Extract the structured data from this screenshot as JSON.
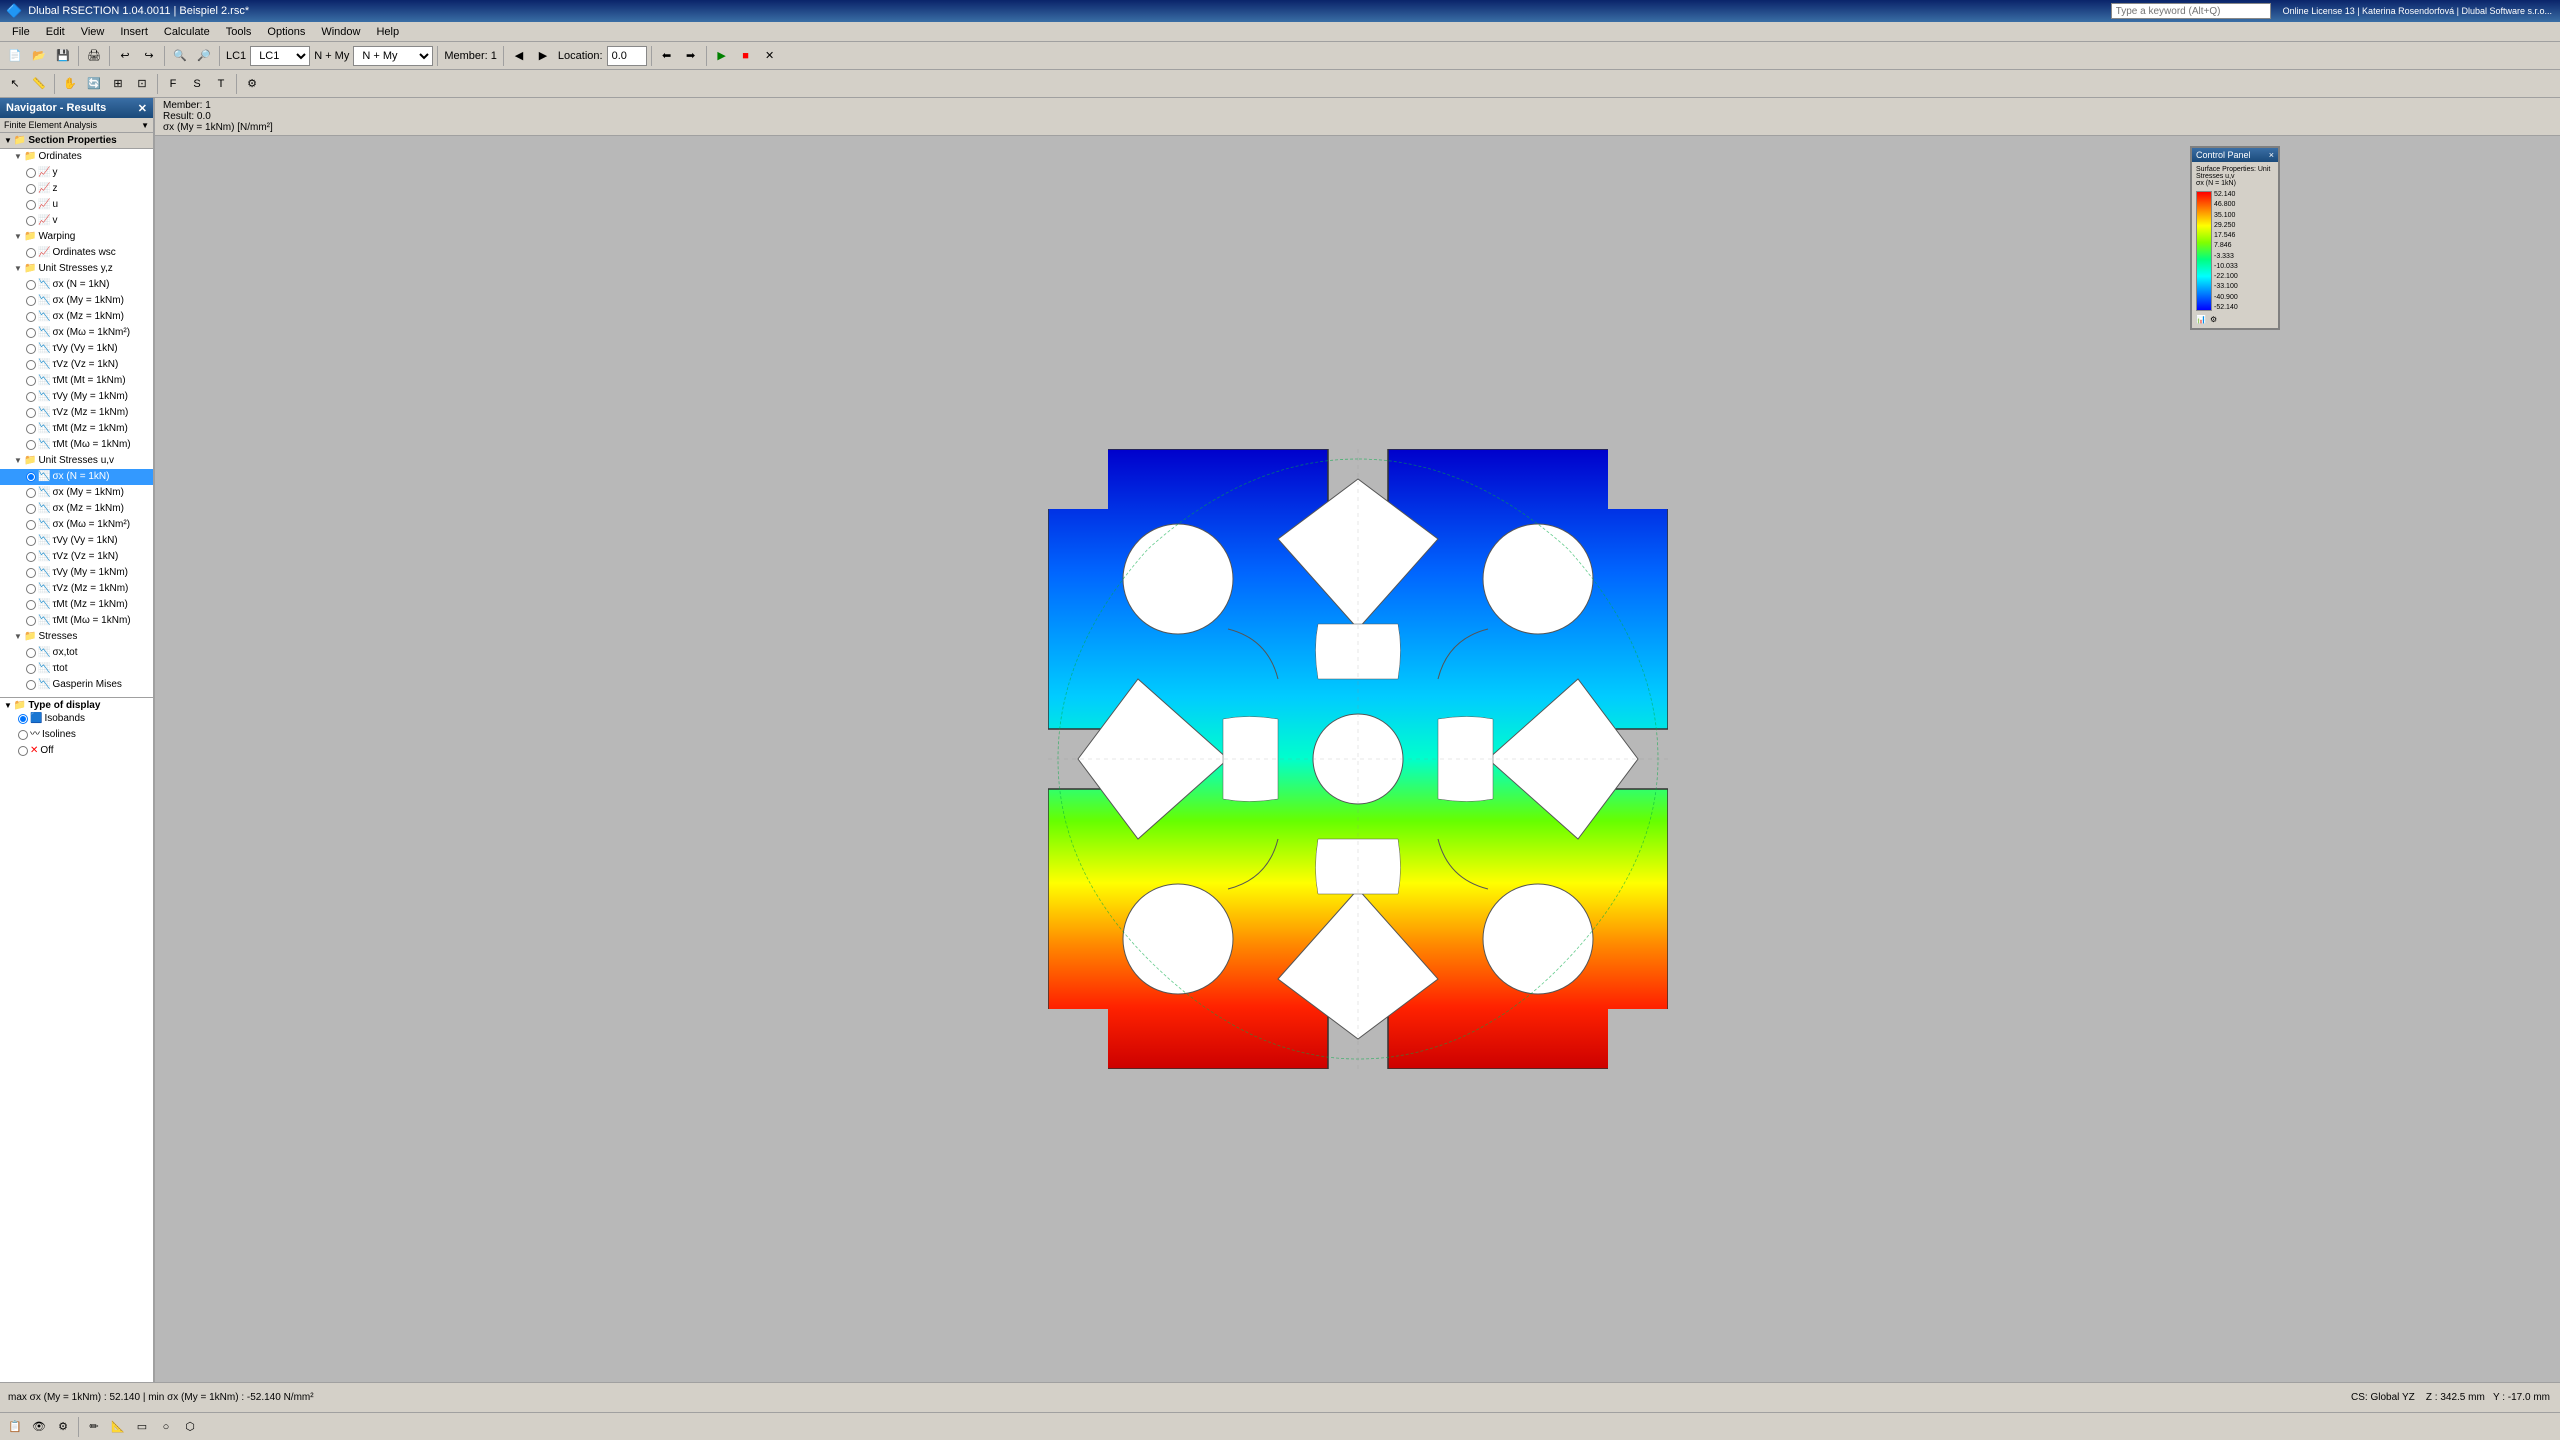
{
  "titlebar": {
    "title": "Dlubal RSECTION 1.04.0011 | Beispiel 2.rsc*",
    "min_label": "─",
    "max_label": "□",
    "close_label": "✕"
  },
  "menubar": {
    "items": [
      "File",
      "Edit",
      "View",
      "Insert",
      "Calculate",
      "Tools",
      "Options",
      "Window",
      "Help"
    ]
  },
  "toolbar1": {
    "lc_combo": "LC1",
    "n_my_combo": "N + My",
    "member_label": "Member: 1",
    "location_label": "Location:",
    "location_value": "0.0"
  },
  "navigator": {
    "title": "Navigator - Results",
    "tab_label": "Finite Element Analysis",
    "section_properties": "Section Properties",
    "tree": [
      {
        "label": "Ordinates",
        "level": 1,
        "type": "folder"
      },
      {
        "label": "y",
        "level": 2,
        "type": "radio"
      },
      {
        "label": "z",
        "level": 2,
        "type": "radio"
      },
      {
        "label": "u",
        "level": 2,
        "type": "radio"
      },
      {
        "label": "v",
        "level": 2,
        "type": "radio"
      },
      {
        "label": "Warping",
        "level": 1,
        "type": "folder"
      },
      {
        "label": "Ordinates wsc",
        "level": 2,
        "type": "radio"
      },
      {
        "label": "Unit Stresses y,z",
        "level": 1,
        "type": "folder"
      },
      {
        "label": "σx (N = 1kN)",
        "level": 2,
        "type": "radio"
      },
      {
        "label": "σx (My = 1kNm)",
        "level": 2,
        "type": "radio"
      },
      {
        "label": "σx (Mz = 1kNm)",
        "level": 2,
        "type": "radio"
      },
      {
        "label": "σx (Mω = 1kNm²)",
        "level": 2,
        "type": "radio"
      },
      {
        "label": "τVy (Vy = 1kN)",
        "level": 2,
        "type": "radio"
      },
      {
        "label": "τVz (Vz = 1kN)",
        "level": 2,
        "type": "radio"
      },
      {
        "label": "τMt (Mt = 1kNm)",
        "level": 2,
        "type": "radio"
      },
      {
        "label": "τVy (My = 1kNm)",
        "level": 2,
        "type": "radio"
      },
      {
        "label": "τVz (Mz = 1kNm)",
        "level": 2,
        "type": "radio"
      },
      {
        "label": "τMt (Mz = 1kNm)",
        "level": 2,
        "type": "radio"
      },
      {
        "label": "τMt (Mω = 1kNm)",
        "level": 2,
        "type": "radio"
      },
      {
        "label": "Unit Stresses u,v",
        "level": 1,
        "type": "folder"
      },
      {
        "label": "σx (N = 1kN)",
        "level": 2,
        "type": "radio",
        "selected": true
      },
      {
        "label": "σx (My = 1kNm)",
        "level": 2,
        "type": "radio"
      },
      {
        "label": "σx (Mz = 1kNm)",
        "level": 2,
        "type": "radio"
      },
      {
        "label": "σx (Mω = 1kNm²)",
        "level": 2,
        "type": "radio"
      },
      {
        "label": "τVy (Vy = 1kN)",
        "level": 2,
        "type": "radio"
      },
      {
        "label": "τVz (Vz = 1kN)",
        "level": 2,
        "type": "radio"
      },
      {
        "label": "τVy (My = 1kNm)",
        "level": 2,
        "type": "radio"
      },
      {
        "label": "τVz (Mz = 1kNm)",
        "level": 2,
        "type": "radio"
      },
      {
        "label": "τMt (Mz = 1kNm)",
        "level": 2,
        "type": "radio"
      },
      {
        "label": "τMt (Mω = 1kNm)",
        "level": 2,
        "type": "radio"
      },
      {
        "label": "Stresses",
        "level": 1,
        "type": "folder"
      },
      {
        "label": "σx,tot",
        "level": 2,
        "type": "radio"
      },
      {
        "label": "τtot",
        "level": 2,
        "type": "radio"
      },
      {
        "label": "Gasperin Mises",
        "level": 2,
        "type": "radio"
      }
    ],
    "type_display_label": "Type of display",
    "display_options": [
      {
        "label": "Isobands",
        "selected": true
      },
      {
        "label": "Isolines",
        "selected": false
      },
      {
        "label": "Off",
        "selected": false
      }
    ]
  },
  "info_panel": {
    "member_label": "Member: 1",
    "result_label": "Result: 0.0",
    "formula": "σx (My = 1kNm) [N/mm²]"
  },
  "control_panel": {
    "title": "Control Panel",
    "close_label": "×",
    "subtitle": "Surface Properties: Unit Stresses u,v σx (N = 1kN)",
    "color_values": [
      "52.140",
      "46.800",
      "35.100",
      "29.250",
      "17.546",
      "7.846",
      "-3.333",
      "-10.033",
      "-22.100",
      "-33.100",
      "-40.900",
      "-52.140"
    ]
  },
  "statusbar": {
    "text": "max σx (My = 1kNm) : 52.140 | min σx (My = 1kNm) : -52.140 N/mm²"
  },
  "bottom_right": {
    "cs_label": "CS: Global YZ",
    "z_label": "Z : 342.5 mm",
    "y_label": "Y : -17.0 mm"
  },
  "search": {
    "placeholder": "Type a keyword (Alt+Q)",
    "license_text": "Online License 13 | Katerina Rosendorfová | Dlubal Software s.r.o..."
  }
}
